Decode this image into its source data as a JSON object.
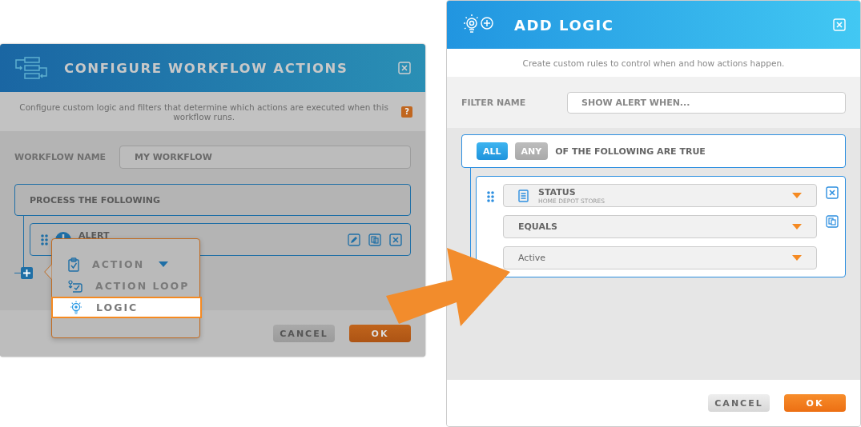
{
  "configure_dialog": {
    "title": "CONFIGURE WORKFLOW ACTIONS",
    "description": "Configure custom logic and filters that determine which actions are executed when this workflow runs.",
    "help_badge": "?",
    "workflow_name_label": "WORKFLOW NAME",
    "workflow_name_value": "MY WORKFLOW",
    "process_label": "PROCESS THE FOLLOWING",
    "action_item": {
      "label": "ALERT"
    },
    "buttons": [
      {
        "label": "CANCEL",
        "kind": "secondary"
      },
      {
        "label": "OK",
        "kind": "primary"
      }
    ]
  },
  "add_menu": {
    "items": [
      {
        "label": "ACTION",
        "kind": "action",
        "dropdown": true,
        "selected": false
      },
      {
        "label": "ACTION LOOP",
        "kind": "loop",
        "dropdown": false,
        "selected": false
      },
      {
        "label": "LOGIC",
        "kind": "logic",
        "dropdown": false,
        "selected": true
      }
    ]
  },
  "logic_dialog": {
    "title": "ADD LOGIC",
    "description": "Create custom rules to control when and how actions happen.",
    "filter_name_label": "FILTER NAME",
    "filter_name_placeholder": "SHOW ALERT WHEN...",
    "match_modes": [
      {
        "label": "ALL",
        "selected": true
      },
      {
        "label": "ANY",
        "selected": false
      }
    ],
    "match_text": "OF THE FOLLOWING ARE TRUE",
    "condition": {
      "field": "STATUS",
      "field_source": "HOME DEPOT STORES",
      "operator": "EQUALS",
      "value": "Active"
    },
    "buttons": [
      {
        "label": "CANCEL",
        "kind": "secondary"
      },
      {
        "label": "OK",
        "kind": "primary"
      }
    ]
  }
}
